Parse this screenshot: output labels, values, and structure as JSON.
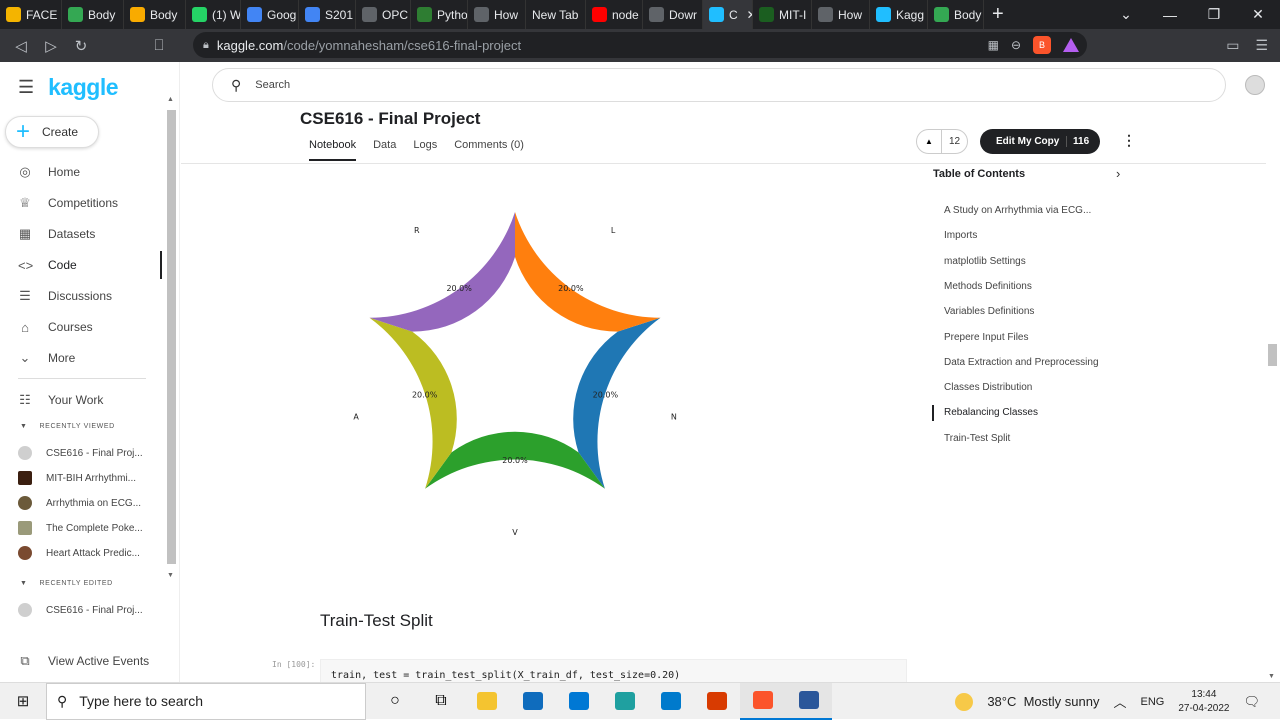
{
  "browser": {
    "tabs": [
      {
        "label": "FACE",
        "icon": "yellow-square-icon",
        "color": "#f4b400"
      },
      {
        "label": "Body",
        "icon": "drive-icon",
        "color": "#34a853"
      },
      {
        "label": "Body",
        "icon": "co-icon",
        "color": "#f9ab00"
      },
      {
        "label": "(1) W",
        "icon": "whatsapp-icon",
        "color": "#25d366"
      },
      {
        "label": "Goog",
        "icon": "google-icon",
        "color": "#4285f4"
      },
      {
        "label": "S201",
        "icon": "docs-icon",
        "color": "#4285f4"
      },
      {
        "label": "OPC",
        "icon": "doc-icon",
        "color": "#5f6368"
      },
      {
        "label": "Pytho",
        "icon": "w-icon",
        "color": "#2e7d32"
      },
      {
        "label": "How",
        "icon": "page-icon",
        "color": "#5f6368"
      },
      {
        "label": "New Tab",
        "icon": "",
        "color": ""
      },
      {
        "label": "node",
        "icon": "youtube-icon",
        "color": "#ff0000"
      },
      {
        "label": "Dowr",
        "icon": "download-icon",
        "color": "#5f6368"
      },
      {
        "label": "C",
        "icon": "kaggle-icon",
        "color": "#20beff",
        "active": true
      },
      {
        "label": "MIT-I",
        "icon": "px-icon",
        "color": "#1b5e20"
      },
      {
        "label": "How",
        "icon": "chart-icon",
        "color": "#5f6368"
      },
      {
        "label": "Kagg",
        "icon": "kaggle-icon",
        "color": "#20beff"
      },
      {
        "label": "Body",
        "icon": "drive-icon",
        "color": "#34a853"
      }
    ],
    "url_host": "kaggle.com",
    "url_path": "/code/yomnahesham/cse616-final-project"
  },
  "sidebar": {
    "logo": "kaggle",
    "create": "Create",
    "items": [
      {
        "label": "Home",
        "icon": "compass-icon"
      },
      {
        "label": "Competitions",
        "icon": "trophy-icon"
      },
      {
        "label": "Datasets",
        "icon": "table-icon"
      },
      {
        "label": "Code",
        "icon": "code-icon",
        "active": true
      },
      {
        "label": "Discussions",
        "icon": "discussion-icon"
      },
      {
        "label": "Courses",
        "icon": "courses-icon"
      },
      {
        "label": "More",
        "icon": "chevron-down-icon"
      }
    ],
    "your_work": "Your Work",
    "recently_viewed_header": "RECENTLY VIEWED",
    "recently_viewed": [
      "CSE616 - Final Proj...",
      "MIT-BIH Arrhythmi...",
      "Arrhythmia on ECG...",
      "The Complete Poke...",
      "Heart Attack Predic..."
    ],
    "recently_edited_header": "RECENTLY EDITED",
    "recently_edited": [
      "CSE616 - Final Proj..."
    ],
    "view_active_events": "View Active Events"
  },
  "header": {
    "search_placeholder": "Search",
    "title": "CSE616 - Final Project",
    "tabs": [
      "Notebook",
      "Data",
      "Logs",
      "Comments (0)"
    ],
    "votes": "12",
    "edit_label": "Edit My Copy",
    "edit_count": "116"
  },
  "toc": {
    "title": "Table of Contents",
    "items": [
      "A Study on Arrhythmia via ECG...",
      "Imports",
      "matplotlib Settings",
      "Methods Definitions",
      "Variables Definitions",
      "Prepere Input Files",
      "Data Extraction and Preprocessing",
      "Classes Distribution",
      "Rebalancing Classes",
      "Train-Test Split"
    ],
    "current_index": 8
  },
  "chart_data": {
    "type": "pie",
    "donut": true,
    "categories": [
      "N",
      "V",
      "A",
      "R",
      "L"
    ],
    "values": [
      20.0,
      20.0,
      20.0,
      20.0,
      20.0
    ],
    "labels": [
      "20.0%",
      "20.0%",
      "20.0%",
      "20.0%",
      "20.0%"
    ],
    "colors": [
      "#1f77b4",
      "#2ca02c",
      "#bcbd22",
      "#9467bd",
      "#ff7f0e"
    ],
    "start_angle_deg": 18,
    "direction": "clockwise"
  },
  "notebook": {
    "section_heading": "Train-Test Split",
    "cell_prompt": "In [100]:",
    "cell_code": "train, test = train_test_split(X_train_df, test_size=0.20)"
  },
  "taskbar": {
    "search_placeholder": "Type here to search",
    "apps": [
      "cortana-icon",
      "taskview-icon",
      "file-explorer-icon",
      "store-icon",
      "mail-icon",
      "edge-icon",
      "vscode-icon",
      "office-icon",
      "brave-icon",
      "word-icon"
    ],
    "weather": "38°C  Mostly sunny",
    "lang": "ENG",
    "time": "13:44",
    "date": "27-04-2022"
  }
}
